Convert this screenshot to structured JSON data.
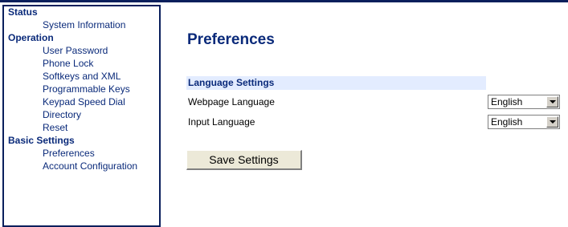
{
  "sidebar": {
    "groups": [
      {
        "title": "Status",
        "items": [
          "System Information"
        ]
      },
      {
        "title": "Operation",
        "items": [
          "User Password",
          "Phone Lock",
          "Softkeys and XML",
          "Programmable Keys",
          "Keypad Speed Dial",
          "Directory",
          "Reset"
        ]
      },
      {
        "title": "Basic Settings",
        "items": [
          "Preferences",
          "Account Configuration"
        ]
      }
    ]
  },
  "main": {
    "title": "Preferences",
    "section_header": "Language Settings",
    "rows": [
      {
        "label": "Webpage Language",
        "value": "English"
      },
      {
        "label": "Input Language",
        "value": "English"
      }
    ],
    "save_label": "Save Settings"
  }
}
